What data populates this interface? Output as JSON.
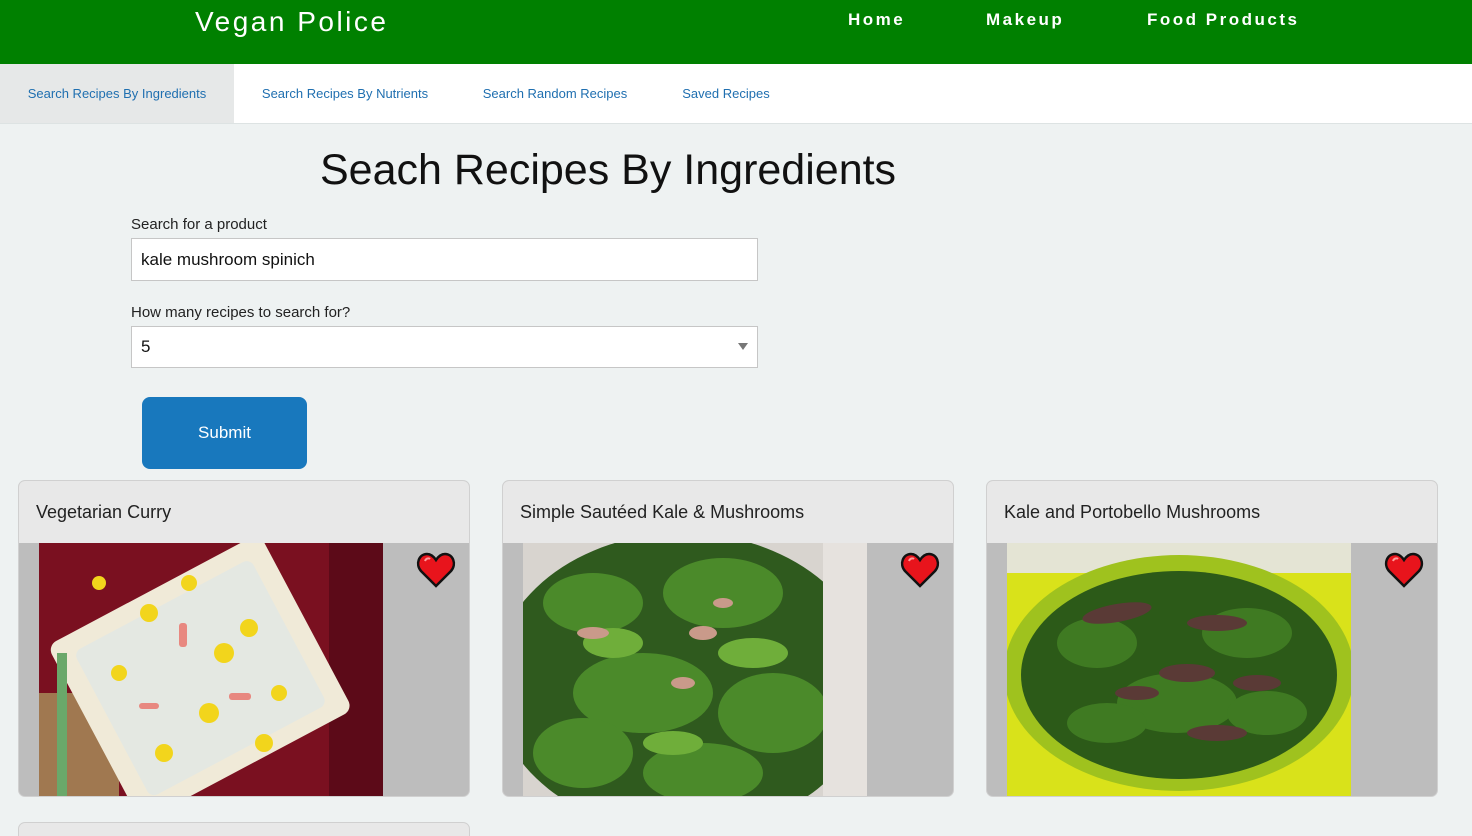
{
  "header": {
    "brand": "Vegan Police",
    "nav": [
      "Home",
      "Makeup",
      "Food Products"
    ]
  },
  "tabs": [
    {
      "label": "Search Recipes By Ingredients",
      "active": true
    },
    {
      "label": "Search Recipes By Nutrients",
      "active": false
    },
    {
      "label": "Search Random Recipes",
      "active": false
    },
    {
      "label": "Saved Recipes",
      "active": false
    }
  ],
  "main": {
    "title": "Seach Recipes By Ingredients",
    "search_label": "Search for a product",
    "search_value": "kale mushroom spinich",
    "count_label": "How many recipes to search for?",
    "count_value": "5",
    "submit_label": "Submit"
  },
  "recipes": [
    {
      "title": "Vegetarian Curry",
      "icon": "heart-icon",
      "heart_color": "#e8141c"
    },
    {
      "title": "Simple Sautéed Kale & Mushrooms",
      "icon": "heart-icon",
      "heart_color": "#e8141c"
    },
    {
      "title": "Kale and Portobello Mushrooms",
      "icon": "heart-icon",
      "heart_color": "#e8141c"
    }
  ],
  "colors": {
    "header_bg": "#008000",
    "accent": "#1878bd",
    "tab_link": "#1f6fb0",
    "page_bg": "#eef2f2"
  }
}
